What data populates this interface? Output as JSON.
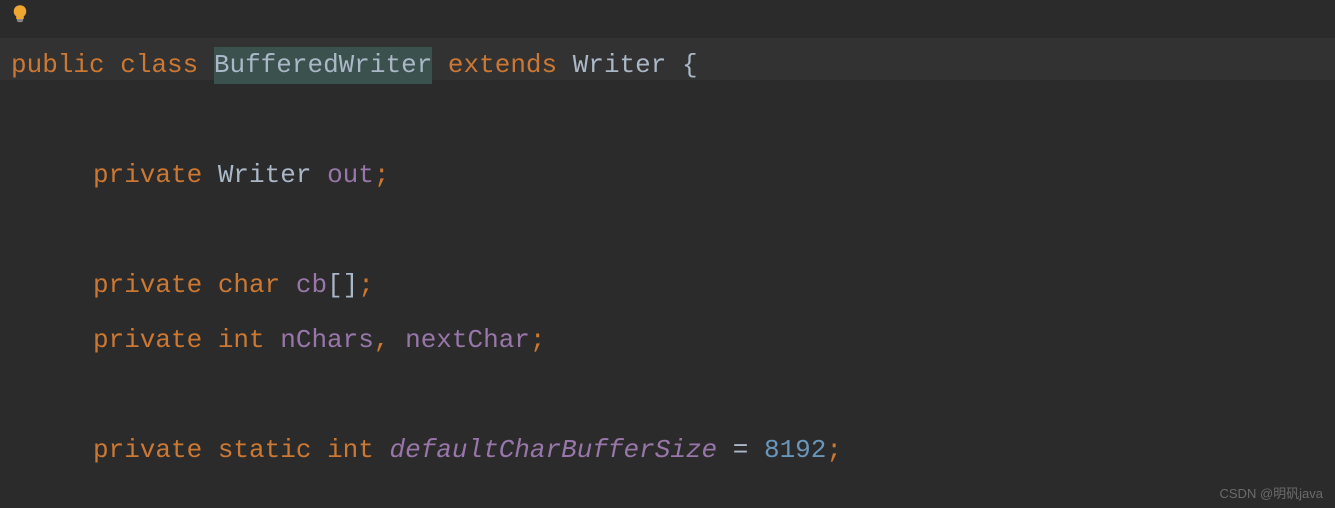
{
  "code": {
    "line1": {
      "kw_public": "public",
      "kw_class": "class",
      "classname": "BufferedWriter",
      "kw_extends": "extends",
      "superclass": "Writer",
      "brace": "{"
    },
    "line3": {
      "kw_private": "private",
      "type": "Writer",
      "field": "out",
      "semi": ";"
    },
    "line5": {
      "kw_private": "private",
      "type": "char",
      "field": "cb",
      "brackets": "[]",
      "semi": ";"
    },
    "line6": {
      "kw_private": "private",
      "type": "int",
      "field1": "nChars",
      "comma": ",",
      "field2": "nextChar",
      "semi": ";"
    },
    "line8": {
      "kw_private": "private",
      "kw_static": "static",
      "type": "int",
      "field": "defaultCharBufferSize",
      "eq": "=",
      "value": "8192",
      "semi": ";"
    }
  },
  "watermark": "CSDN @明矾java"
}
